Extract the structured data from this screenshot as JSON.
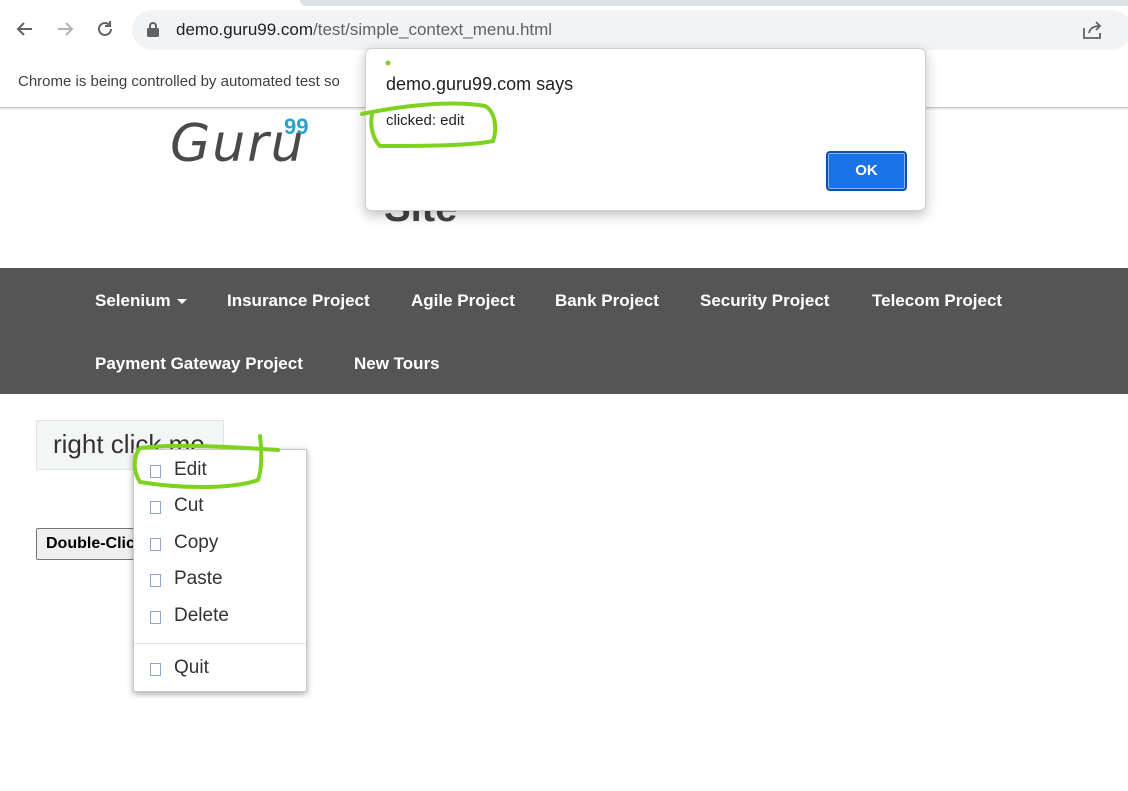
{
  "browser": {
    "url_domain": "demo.guru99.com",
    "url_path": "/test/simple_context_menu.html",
    "infobar_text": "Chrome is being controlled by automated test so"
  },
  "page": {
    "logo_text": "Guru",
    "logo_sup": "99",
    "heading_fragment": "Site",
    "nav": [
      {
        "label": "Selenium"
      },
      {
        "label": "Insurance Project"
      },
      {
        "label": "Agile Project"
      },
      {
        "label": "Bank Project"
      },
      {
        "label": "Security Project"
      },
      {
        "label": "Telecom Project"
      },
      {
        "label": "Payment Gateway Project"
      },
      {
        "label": "New Tours"
      }
    ],
    "right_click_label": "right click me",
    "double_click_label": "Double-Click Me To See Alert"
  },
  "context_menu": {
    "items": [
      {
        "label": "Edit"
      },
      {
        "label": "Cut"
      },
      {
        "label": "Copy"
      },
      {
        "label": "Paste"
      },
      {
        "label": "Delete"
      },
      {
        "label": "Quit"
      }
    ]
  },
  "dialog": {
    "title": "demo.guru99.com says",
    "message": "clicked: edit",
    "ok_label": "OK"
  },
  "colors": {
    "navbar": "#555555",
    "ok_button": "#1a73e8",
    "annotation": "#7ed321",
    "logo_sup": "#2aa3c9"
  }
}
